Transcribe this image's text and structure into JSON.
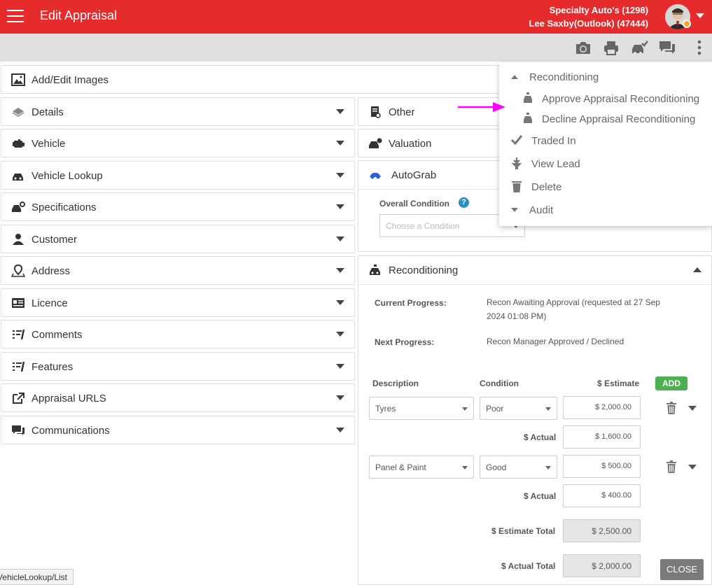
{
  "header": {
    "title": "Edit Appraisal",
    "dealer": "Specialty Auto's (1298)",
    "user": "Lee Saxby(Outlook) (47444)"
  },
  "left_panels": [
    {
      "label": "Add/Edit Images",
      "icon": "image-icon"
    },
    {
      "label": "Details",
      "icon": "layers-icon"
    },
    {
      "label": "Vehicle",
      "icon": "engine-icon"
    },
    {
      "label": "Vehicle Lookup",
      "icon": "car-search-icon"
    },
    {
      "label": "Specifications",
      "icon": "car-settings-icon"
    },
    {
      "label": "Customer",
      "icon": "user-icon"
    },
    {
      "label": "Address",
      "icon": "map-pin-icon"
    },
    {
      "label": "Licence",
      "icon": "id-card-icon"
    },
    {
      "label": "Comments",
      "icon": "comment-list-icon"
    },
    {
      "label": "Features",
      "icon": "feature-list-icon"
    },
    {
      "label": "Appraisal URLS",
      "icon": "external-link-icon"
    },
    {
      "label": "Communications",
      "icon": "chat-icon"
    }
  ],
  "right_panels": {
    "other": "Other",
    "valuation": "Valuation",
    "autograb": "AutoGrab",
    "overall_condition_label": "Overall Condition",
    "condition_placeholder": "Choose a Condition",
    "reconditioning": "Reconditioning"
  },
  "recon": {
    "current_progress_label": "Current Progress:",
    "current_progress_value_1": "Recon Awaiting Approval (requested at 27 Sep",
    "current_progress_value_2": "2024 01:08 PM)",
    "next_progress_label": "Next Progress:",
    "next_progress_value": "Recon Manager Approved / Declined",
    "col_description": "Description",
    "col_condition": "Condition",
    "col_estimate": "$ Estimate",
    "add_label": "ADD",
    "actual_label": "$ Actual",
    "rows": [
      {
        "description": "Tyres",
        "condition": "Poor",
        "estimate": "$ 2,000.00",
        "actual": "$ 1,600.00"
      },
      {
        "description": "Panel & Paint",
        "condition": "Good",
        "estimate": "$ 500.00",
        "actual": "$ 400.00"
      }
    ],
    "estimate_total_label": "$ Estimate Total",
    "estimate_total": "$ 2,500.00",
    "actual_total_label": "$ Actual Total",
    "actual_total": "$ 2,000.00",
    "close_label": "CLOSE"
  },
  "menu": {
    "reconditioning": "Reconditioning",
    "approve": "Approve Appraisal Reconditioning",
    "decline": "Decline Appraisal Reconditioning",
    "traded_in": "Traded In",
    "view_lead": "View Lead",
    "delete": "Delete",
    "audit": "Audit"
  },
  "status_url": "VehicleLookup/List",
  "colors": {
    "brand": "#e52b2b",
    "add": "#4caf50",
    "arrow": "#ff00ff"
  }
}
